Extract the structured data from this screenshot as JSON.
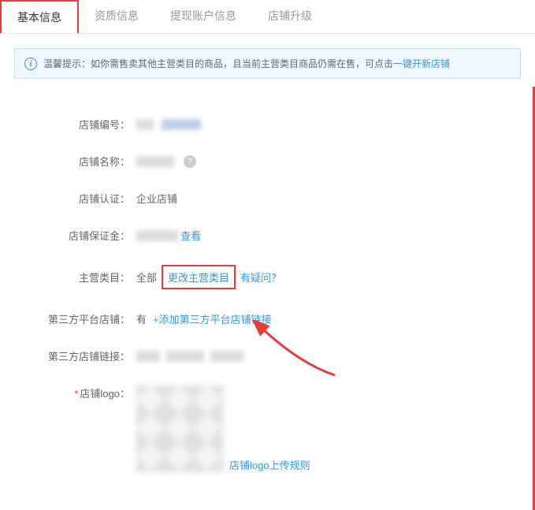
{
  "tabs": {
    "items": [
      {
        "label": "基本信息",
        "active": true
      },
      {
        "label": "资质信息",
        "active": false
      },
      {
        "label": "提现账户信息",
        "active": false
      },
      {
        "label": "店铺升级",
        "active": false
      }
    ]
  },
  "tip": {
    "prefix": "温馨提示：",
    "text": "如你需售卖其他主营类目的商品，且当前主营类目商品仍需在售，可点击",
    "link": "一键开新店铺"
  },
  "fields": {
    "shop_id_label": "店铺编号：",
    "shop_name_label": "店铺名称：",
    "shop_cert_label": "店铺认证：",
    "shop_cert_value": "企业店铺",
    "deposit_label": "店铺保证金：",
    "deposit_link": "查看",
    "category_label": "主营类目：",
    "category_value": "全部",
    "category_change": "更改主营类目",
    "category_help": "有疑问？",
    "third_platform_label": "第三方平台店铺：",
    "third_platform_value": "有",
    "third_platform_add": "+添加第三方平台店铺链接",
    "third_link_label": "第三方店铺链接：",
    "logo_label": "店铺logo：",
    "logo_required": "*",
    "logo_rule_link": "店铺logo上传规则"
  }
}
